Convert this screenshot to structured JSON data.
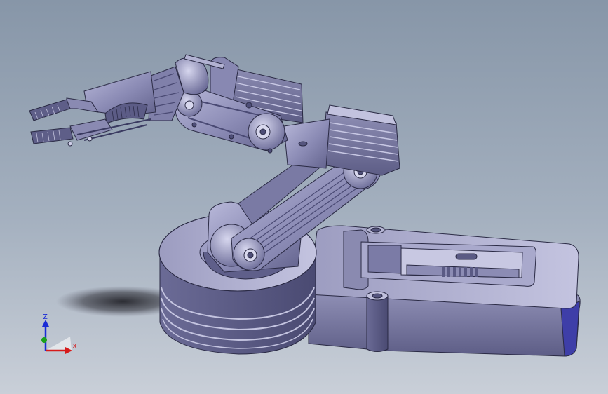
{
  "viewport": {
    "background_top": "#8796a8",
    "background_bottom": "#c9cfd8",
    "model_color": "#7f7fa8"
  },
  "triad": {
    "z_label": "Z",
    "x_label": "X",
    "z_color": "#1a2bd6",
    "x_color": "#d61a1a",
    "y_color": "#1aa11a"
  }
}
